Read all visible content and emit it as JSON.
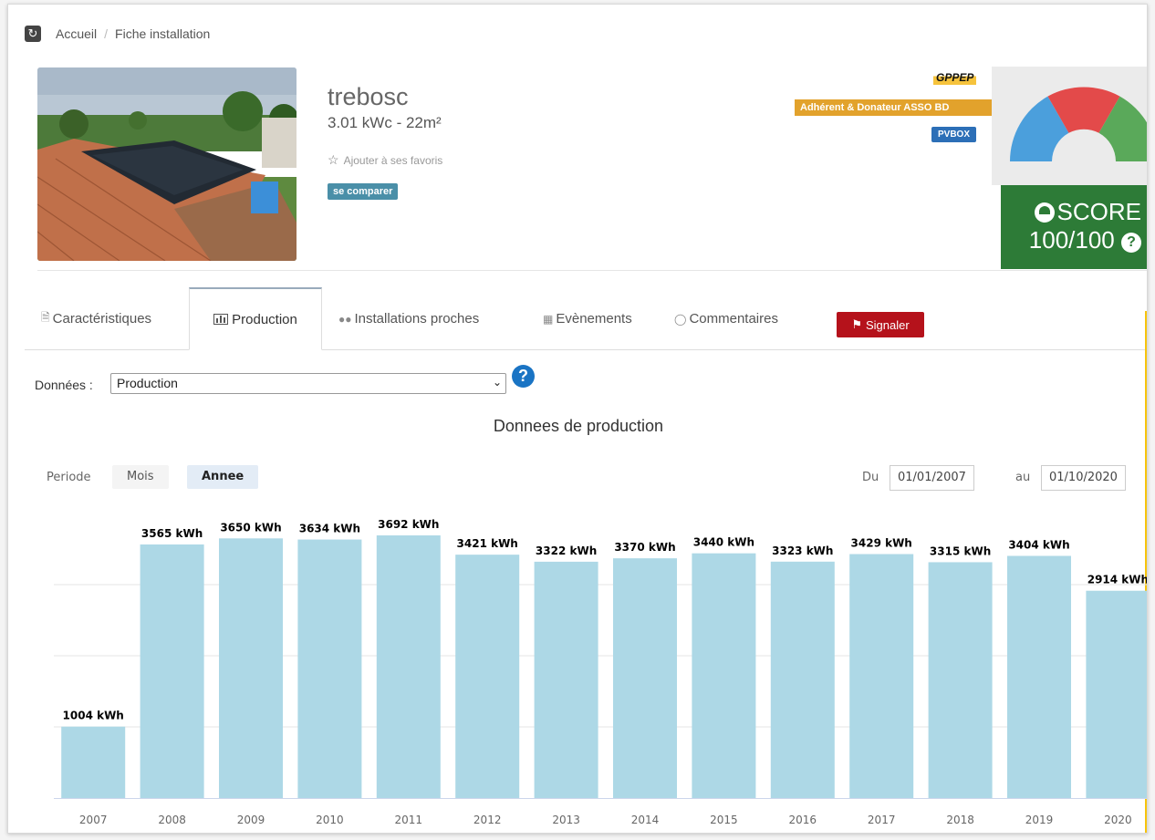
{
  "breadcrumb": {
    "home": "Accueil",
    "separator": "/",
    "current": "Fiche installation"
  },
  "installation": {
    "name": "trebosc",
    "specs": "3.01 kWc - 22m²",
    "favorite_label": "Ajouter à ses favoris",
    "compare_label": "se comparer"
  },
  "badges": {
    "gppep": "GPPEP",
    "asso": "Adhérent & Donateur ASSO BD",
    "pvbox": "PVBOX"
  },
  "score": {
    "label": "SCORE",
    "value": "100/100",
    "help_icon": "question-circle-icon",
    "gauge_colors": [
      "#4b9fdc",
      "#e34a4a",
      "#5aa95a"
    ]
  },
  "tabs": [
    {
      "label": "Caractéristiques",
      "icon": "document-icon"
    },
    {
      "label": "Production",
      "icon": "bar-chart-icon",
      "active": true
    },
    {
      "label": "Installations proches",
      "icon": "users-icon"
    },
    {
      "label": "Evènements",
      "icon": "calendar-icon"
    },
    {
      "label": "Commentaires",
      "icon": "comment-icon"
    }
  ],
  "report_button": {
    "label": "Signaler",
    "icon": "bullhorn-icon",
    "color": "#b5121b"
  },
  "data_select": {
    "label": "Données :",
    "value": "Production",
    "help": "?"
  },
  "period": {
    "label": "Periode",
    "month": "Mois",
    "year": "Annee",
    "from_label": "Du",
    "from": "01/01/2007",
    "to_label": "au",
    "to": "01/10/2020"
  },
  "chart_data": {
    "type": "bar",
    "title": "Donnees de production",
    "categories": [
      "2007",
      "2008",
      "2009",
      "2010",
      "2011",
      "2012",
      "2013",
      "2014",
      "2015",
      "2016",
      "2017",
      "2018",
      "2019",
      "2020"
    ],
    "values": [
      1004,
      3565,
      3650,
      3634,
      3692,
      3421,
      3322,
      3370,
      3440,
      3323,
      3429,
      3315,
      3404,
      2914
    ],
    "data_labels": [
      "1004 kWh",
      "3565 kWh",
      "3650 kWh",
      "3634 kWh",
      "3692 kWh",
      "3421 kWh",
      "3322 kWh",
      "3370 kWh",
      "3440 kWh",
      "3323 kWh",
      "3429 kWh",
      "3315 kWh",
      "3404 kWh",
      "2914 kWh"
    ],
    "unit": "kWh",
    "ylim": [
      0,
      4000
    ],
    "bar_color": "#add8e6",
    "grid": true
  }
}
